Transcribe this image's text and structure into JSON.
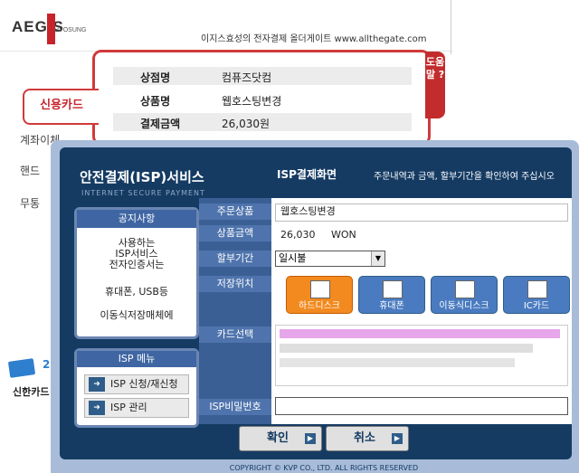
{
  "background": {
    "logo": "AEGIS",
    "logo_sub": "HYOSUNG",
    "vendor_text": "이지스효성의 전자결제 올더게이트 www.allthegate.com",
    "help_tab": "도움말 ?",
    "order_info": [
      {
        "label": "상점명",
        "value": "컴퓨즈닷컴"
      },
      {
        "label": "상품명",
        "value": "웹호스팅변경"
      },
      {
        "label": "결제금액",
        "value": "26,030원"
      }
    ],
    "side_menu": [
      {
        "label": "신용카드"
      },
      {
        "label": "계좌이체"
      },
      {
        "label": "핸드"
      },
      {
        "label": "무통"
      }
    ],
    "card_number_badge": "2",
    "card_company": "신한카드"
  },
  "isp": {
    "title": "안전결제(ISP)서비스",
    "subtitle": "INTERNET SECURE PAYMENT",
    "notice": {
      "heading": "공지사항",
      "lines": [
        "사용하는",
        "ISP서비스",
        "전자인증서는",
        "휴대폰, USB등",
        "이동식저장매체에"
      ]
    },
    "menu": {
      "heading": "ISP 메뉴",
      "items": [
        {
          "label": "ISP 신청/재신청"
        },
        {
          "label": "ISP 관리"
        }
      ]
    },
    "screen_title": "ISP결제화면",
    "screen_desc": "주문내역과 금액, 할부기간을 확인하여 주십시오",
    "form": {
      "product_label": "주문상품",
      "product_value": "웹호스팅변경",
      "amount_label": "상품금액",
      "amount_value": "26,030",
      "amount_unit": "WON",
      "installment_label": "할부기간",
      "installment_value": "일시불",
      "storage_label": "저장위치",
      "storage_options": [
        {
          "label": "하드디스크",
          "color": "#f28a1f"
        },
        {
          "label": "휴대폰",
          "color": "#4a7bc0"
        },
        {
          "label": "이동식디스크",
          "color": "#4a7bc0"
        },
        {
          "label": "IC카드",
          "color": "#4a7bc0"
        }
      ],
      "card_select_label": "카드선택",
      "password_label": "ISP비밀번호"
    },
    "buttons": {
      "confirm": "확인",
      "cancel": "취소"
    },
    "copyright": "COPYRIGHT © KVP CO., LTD. ALL RIGHTS RESERVED"
  }
}
